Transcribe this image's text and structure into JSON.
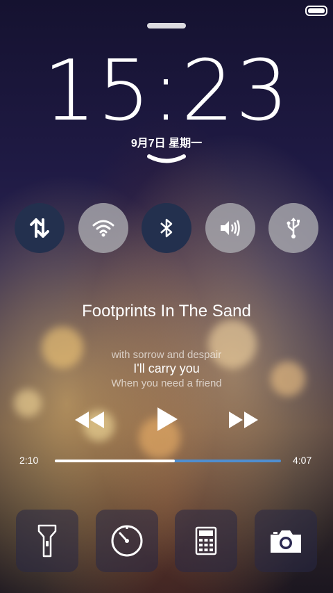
{
  "clock": {
    "time": "15:23",
    "date": "9月7日  星期一"
  },
  "quick_toggles": [
    {
      "icon": "sync-icon",
      "state": "on"
    },
    {
      "icon": "wifi-icon",
      "state": "off"
    },
    {
      "icon": "bluetooth-icon",
      "state": "on"
    },
    {
      "icon": "volume-icon",
      "state": "off"
    },
    {
      "icon": "usb-icon",
      "state": "off"
    }
  ],
  "music": {
    "title": "Footprints In The Sand",
    "lyrics": {
      "previous": "with sorrow and despair",
      "current": "I'll carry you",
      "next": "When you need a friend"
    },
    "elapsed": "2:10",
    "duration": "4:07",
    "progress_fraction": 0.53
  },
  "shortcuts": [
    {
      "icon": "flashlight-icon"
    },
    {
      "icon": "timer-icon"
    },
    {
      "icon": "calculator-icon"
    },
    {
      "icon": "camera-icon"
    }
  ],
  "colors": {
    "toggle_on": "#23304e",
    "toggle_off": "#aaaaaf",
    "progress_remaining": "#4f8ed0",
    "progress_elapsed": "#ffffff"
  }
}
